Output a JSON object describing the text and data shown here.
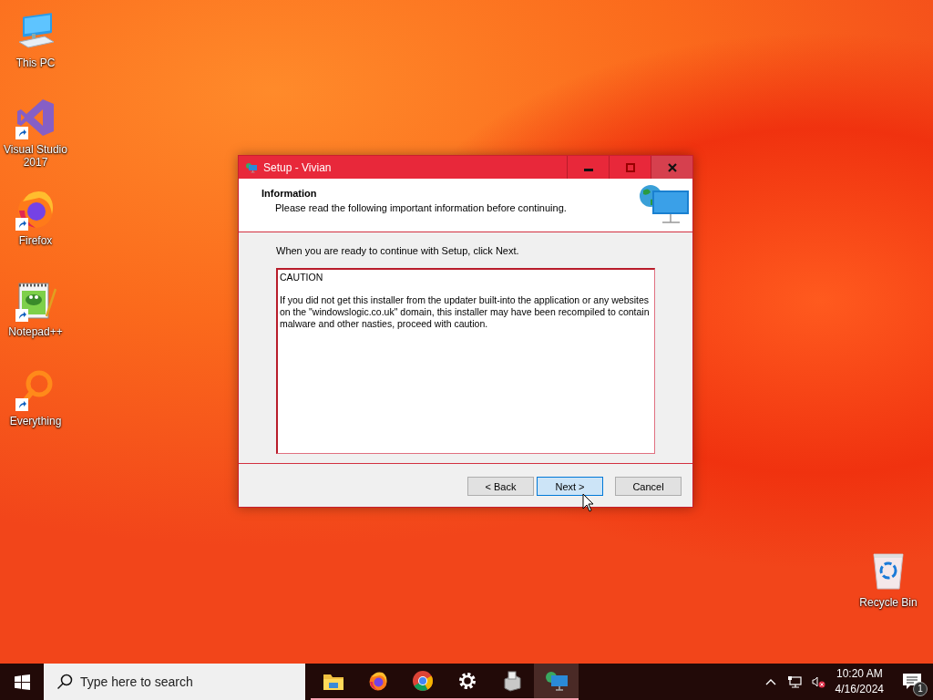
{
  "desktop_icons": [
    {
      "label": "This PC",
      "kind": "computer",
      "shortcut": false
    },
    {
      "label": "Visual Studio 2017",
      "kind": "vs",
      "shortcut": true
    },
    {
      "label": "Firefox",
      "kind": "firefox",
      "shortcut": true
    },
    {
      "label": "Notepad++",
      "kind": "notepad",
      "shortcut": true
    },
    {
      "label": "Everything",
      "kind": "everything",
      "shortcut": true
    }
  ],
  "recycle_bin": {
    "label": "Recycle Bin"
  },
  "window": {
    "title": "Setup - Vivian",
    "header": {
      "title": "Information",
      "subtitle": "Please read the following important information before continuing."
    },
    "intro": "When you are ready to continue with Setup, click Next.",
    "memo": [
      "CAUTION",
      "If you did not get this installer from the updater built-into the application or any websites on the \"windowslogic.co.uk\" domain, this installer may have been recompiled to contain malware and other nasties, proceed with caution."
    ],
    "buttons": [
      {
        "label": "< Back",
        "focused": false
      },
      {
        "label": "Next >",
        "focused": true
      },
      {
        "label": "Cancel",
        "focused": false
      }
    ]
  },
  "taskbar": {
    "search": {
      "placeholder": "Type here to search"
    },
    "apps": [
      {
        "kind": "folder",
        "running": true,
        "active": false
      },
      {
        "kind": "firefox",
        "running": true,
        "active": false
      },
      {
        "kind": "chrome",
        "running": true,
        "active": false
      },
      {
        "kind": "gear",
        "running": true,
        "active": false
      },
      {
        "kind": "drive",
        "running": true,
        "active": false
      },
      {
        "kind": "setup",
        "running": true,
        "active": true
      }
    ],
    "time": "10:20 AM",
    "date": "4/16/2024",
    "notifications": "1"
  }
}
